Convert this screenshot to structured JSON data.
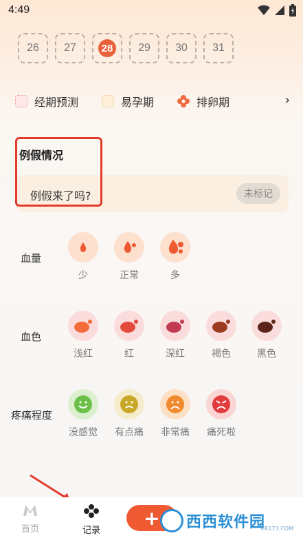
{
  "status_bar": {
    "time": "4:49",
    "icons": [
      "wifi-icon",
      "signal-icon",
      "battery-icon"
    ]
  },
  "calendar": {
    "dates": [
      {
        "label": "26"
      },
      {
        "label": "27"
      },
      {
        "label": "28",
        "today": true
      },
      {
        "label": "29"
      },
      {
        "label": "30"
      },
      {
        "label": "31"
      }
    ]
  },
  "legend": {
    "items": [
      {
        "label": "经期预测"
      },
      {
        "label": "易孕期"
      },
      {
        "label": "排卵期"
      }
    ],
    "more": "›"
  },
  "period": {
    "title": "例假情况",
    "question": "例假来了吗?",
    "unmark": "未标记"
  },
  "flow": {
    "label": "血量",
    "options": [
      {
        "label": "少",
        "icon": "drop-small-icon"
      },
      {
        "label": "正常",
        "icon": "drop-normal-icon"
      },
      {
        "label": "多",
        "icon": "drop-large-icon"
      }
    ]
  },
  "color": {
    "label": "血色",
    "options": [
      {
        "label": "浅红",
        "color": "#f26b3a"
      },
      {
        "label": "红",
        "color": "#e24a3b"
      },
      {
        "label": "深红",
        "color": "#c23a52"
      },
      {
        "label": "褐色",
        "color": "#9a3b22"
      },
      {
        "label": "黑色",
        "color": "#5a2418"
      }
    ]
  },
  "pain": {
    "label": "疼痛程度",
    "options": [
      {
        "label": "没感觉",
        "icon": "face-happy-icon",
        "color": "#6cc04a"
      },
      {
        "label": "有点痛",
        "icon": "face-meh-icon",
        "color": "#c9a829"
      },
      {
        "label": "非常痛",
        "icon": "face-sad-icon",
        "color": "#f08a2e"
      },
      {
        "label": "痛死啦",
        "icon": "face-crying-icon",
        "color": "#e23b3b"
      }
    ]
  },
  "tabbar": {
    "home": "首页",
    "record": "记录",
    "add": "+"
  },
  "watermark": {
    "text": "西西软件园",
    "sub": "CR173.COM"
  },
  "colors": {
    "accent": "#ef5a33",
    "highlight_box": "#e23b2d"
  }
}
